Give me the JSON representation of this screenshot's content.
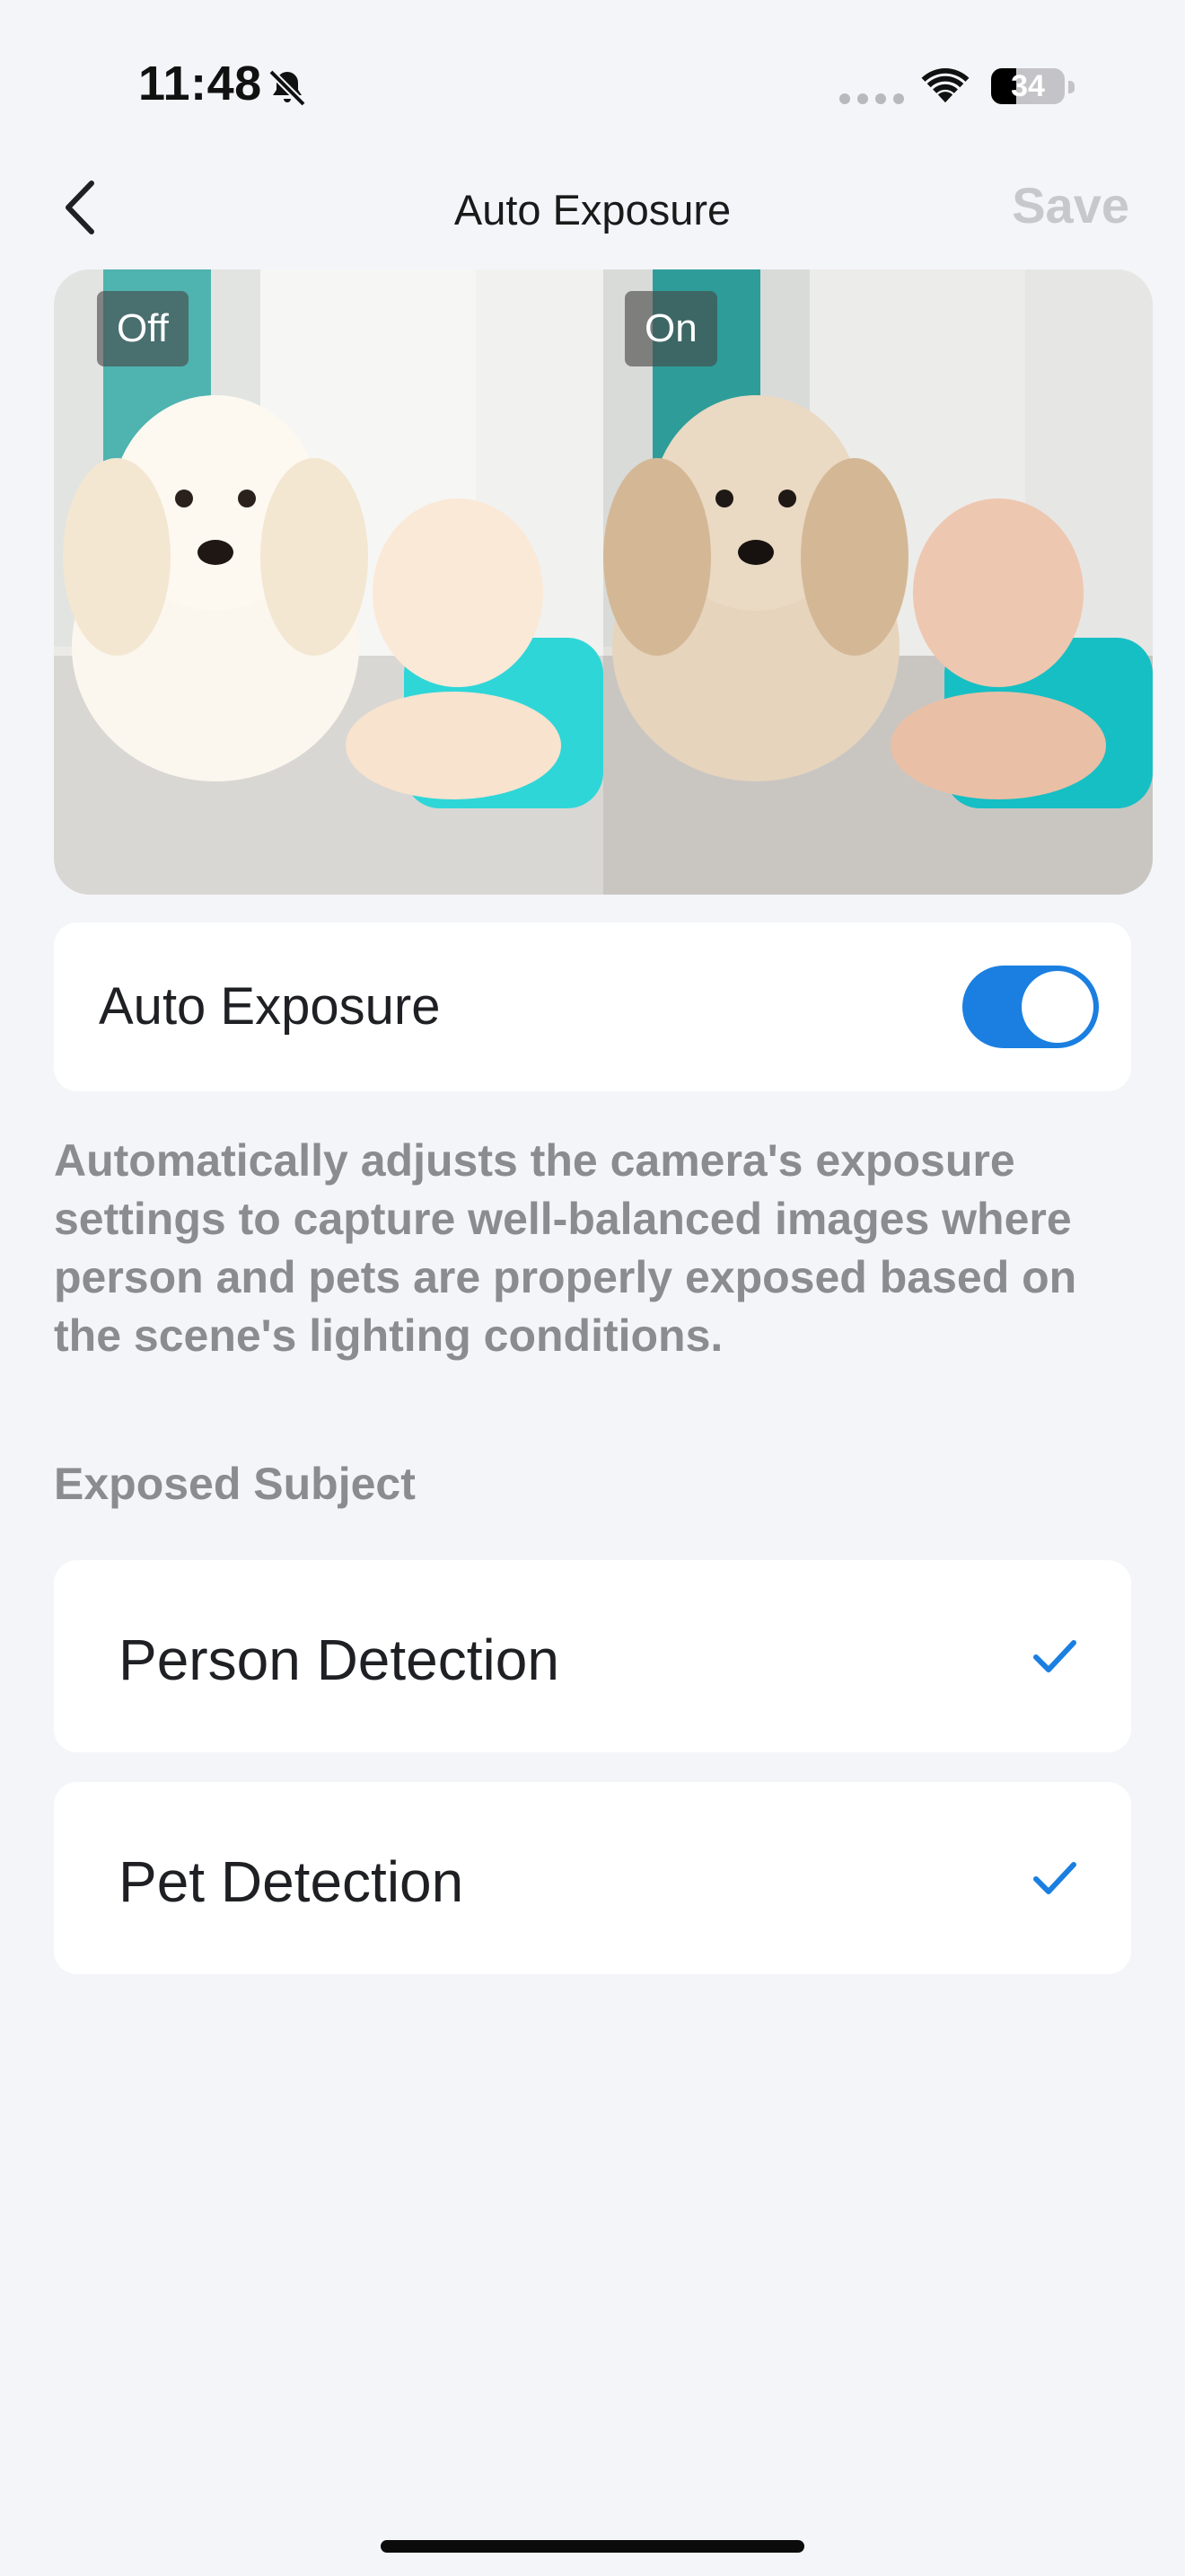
{
  "status_bar": {
    "time": "11:48",
    "battery_level": "34",
    "battery_fraction": 0.34,
    "icons": [
      "bell-slash-icon",
      "cellular-signal-icon",
      "wifi-icon",
      "battery-icon"
    ]
  },
  "nav": {
    "back_icon": "chevron-left-icon",
    "title": "Auto Exposure",
    "save_label": "Save"
  },
  "preview": {
    "off_label": "Off",
    "on_label": "On"
  },
  "setting": {
    "label": "Auto Exposure",
    "enabled": true
  },
  "description": "Automatically adjusts the camera's exposure settings to capture well-balanced images where person and pets are properly exposed based on the scene's lighting conditions.",
  "section": {
    "header": "Exposed Subject",
    "options": [
      {
        "label": "Person Detection",
        "checked": true
      },
      {
        "label": "Pet Detection",
        "checked": true
      }
    ]
  },
  "colors": {
    "accent": "#1a7fe0",
    "background": "#f4f5f9",
    "secondary_text": "#8b8c90",
    "disabled_text": "#c7c8cc"
  }
}
